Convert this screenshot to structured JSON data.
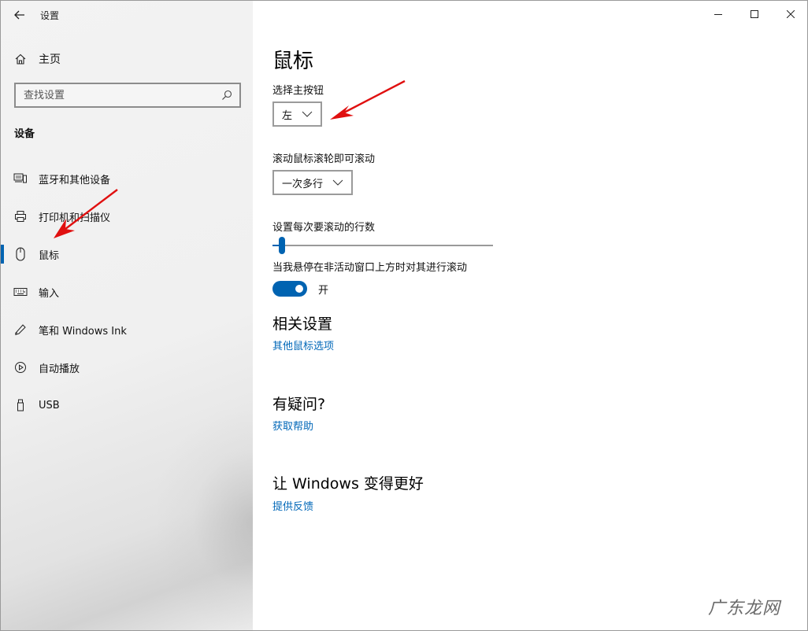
{
  "app": {
    "title": "设置",
    "back_icon": "back-arrow-icon"
  },
  "window_controls": {
    "minimize_icon": "minimize-icon",
    "maximize_icon": "maximize-icon",
    "close_icon": "close-icon"
  },
  "sidebar": {
    "home": {
      "label": "主页",
      "icon": "home-icon"
    },
    "search": {
      "placeholder": "查找设置",
      "value": "",
      "icon": "search-icon"
    },
    "section": "设备",
    "items": [
      {
        "label": "蓝牙和其他设备",
        "icon": "bluetooth-devices-icon",
        "selected": false
      },
      {
        "label": "打印机和扫描仪",
        "icon": "printer-icon",
        "selected": false
      },
      {
        "label": "鼠标",
        "icon": "mouse-icon",
        "selected": true
      },
      {
        "label": "输入",
        "icon": "keyboard-icon",
        "selected": false
      },
      {
        "label": "笔和 Windows Ink",
        "icon": "pen-icon",
        "selected": false
      },
      {
        "label": "自动播放",
        "icon": "autoplay-icon",
        "selected": false
      },
      {
        "label": "USB",
        "icon": "usb-icon",
        "selected": false
      }
    ]
  },
  "main": {
    "title": "鼠标",
    "primary_button": {
      "label": "选择主按钮",
      "value": "左"
    },
    "scroll_mode": {
      "label": "滚动鼠标滚轮即可滚动",
      "value": "一次多行"
    },
    "lines_to_scroll": {
      "label": "设置每次要滚动的行数",
      "value_fraction": 0.03
    },
    "inactive_scroll": {
      "label": "当我悬停在非活动窗口上方时对其进行滚动",
      "state": "开",
      "on": true
    },
    "related": {
      "title": "相关设置",
      "link": "其他鼠标选项"
    },
    "question": {
      "title": "有疑问?",
      "link": "获取帮助"
    },
    "feedback": {
      "title": "让 Windows 变得更好",
      "link": "提供反馈"
    }
  },
  "annotations": {
    "arrow_color": "#e01010"
  },
  "watermark": "广东龙网",
  "colors": {
    "accent": "#0063b1",
    "link": "#0067b8",
    "sidebar_bg": "#f0f0f0"
  }
}
